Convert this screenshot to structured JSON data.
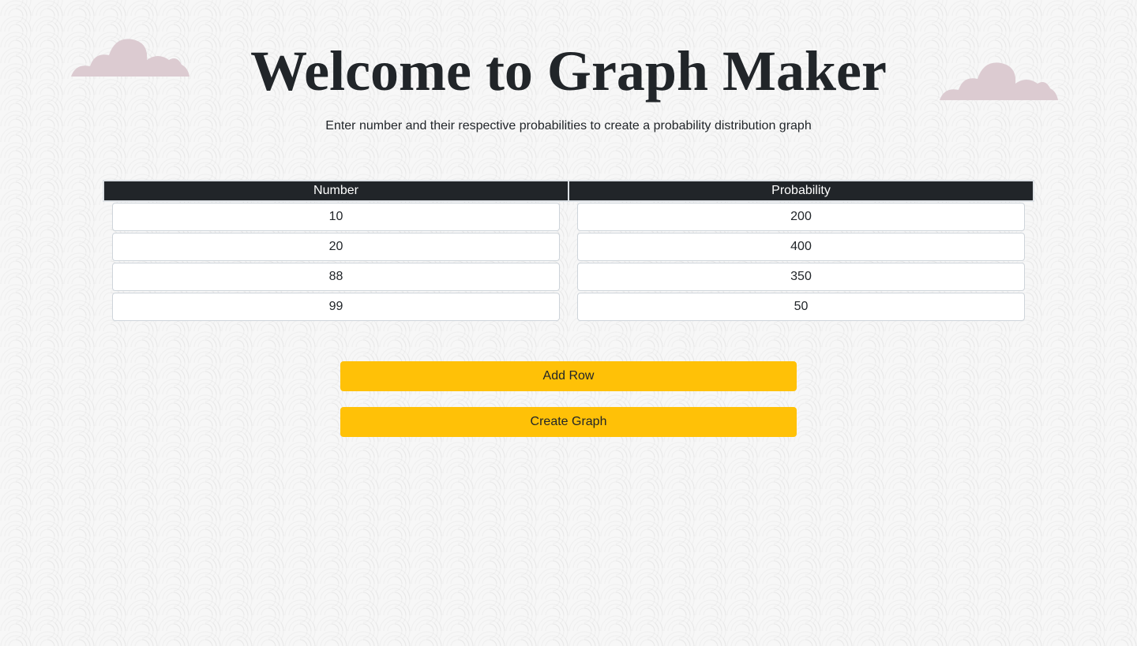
{
  "header": {
    "title": "Welcome to Graph Maker",
    "subtitle": "Enter number and their respective probabilities to create a probability distribution graph"
  },
  "table": {
    "columns": [
      "Number",
      "Probability"
    ],
    "rows": [
      {
        "number": "10",
        "probability": "200"
      },
      {
        "number": "20",
        "probability": "400"
      },
      {
        "number": "88",
        "probability": "350"
      },
      {
        "number": "99",
        "probability": "50"
      }
    ]
  },
  "actions": {
    "add_row_label": "Add Row",
    "create_graph_label": "Create Graph"
  },
  "colors": {
    "button": "#ffc107",
    "table_header": "#212529",
    "cloud": "#dccbd1"
  },
  "icons": {
    "decorations": [
      "cloud-icon",
      "cloud-icon"
    ]
  }
}
